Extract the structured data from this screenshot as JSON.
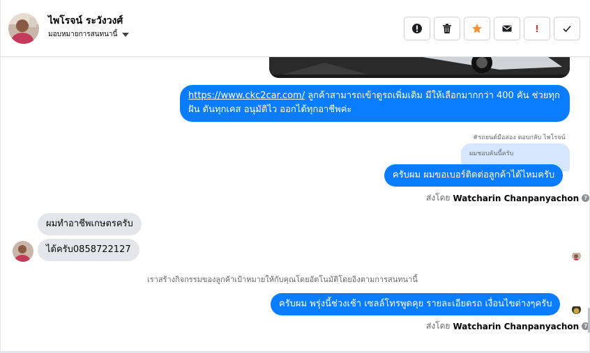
{
  "header": {
    "contact_name": "ไพโรจน์ ระวังวงศ์",
    "assign_label": "มอบหมายการสนทนานี้",
    "actions": [
      {
        "name": "spam-icon",
        "color": "#1c1e21"
      },
      {
        "name": "trash-icon",
        "color": "#1c1e21"
      },
      {
        "name": "star-icon",
        "color": "#f7923b"
      },
      {
        "name": "mail-icon",
        "color": "#1c1e21"
      },
      {
        "name": "important-icon",
        "label": "!",
        "color": "#e02e24"
      },
      {
        "name": "check-icon",
        "color": "#1c1e21"
      }
    ]
  },
  "messages": {
    "link_text": "https://www.ckc2car.com/",
    "msg1_rest_line1": " ลูกค้าสามารถเข้าดูรถเพิ่มเติม มีให้เลือกมากกว่า 400 คัน ช่วยทุก",
    "msg1_line2": "ฝัน ดันทุกเคส อนุมัติไว ออกได้ทุกอาชีพค่ะ",
    "reply_meta": "#รถยนต์มือสอง ตอบกลับ ไพโรจน์",
    "quoted_text": "ผมชอบคันนี้ครับ",
    "msg2": "ครับผม ผมขอเบอร์ติดต่อลูกค้าได้ไหมครับ",
    "sent_by_prefix": "ส่งโดย",
    "sent_by_name": "Watcharin Chanpanyachon",
    "msg_in1": "ผมทำอาชีพเกษตรครับ",
    "msg_in2": "ได้ครับ0858722127",
    "system_line": "เราสร้างกิจกรรมของลูกค้าเป้าหมายให้กับคุณโดยอัตโนมัติโดยอิงตามการสนทนานี้",
    "msg3": "ครับผม พรุ่งนี้ช่วงเช้า เซลล์โทรพูดคุย รายละเอียดรถ เงื่อนไขต่างๆครับ",
    "info_glyph": "?"
  },
  "colors": {
    "outgoing": "#0a7cff",
    "incoming": "#e4e6eb",
    "accent_star": "#f7923b",
    "accent_alert": "#e02e24"
  }
}
